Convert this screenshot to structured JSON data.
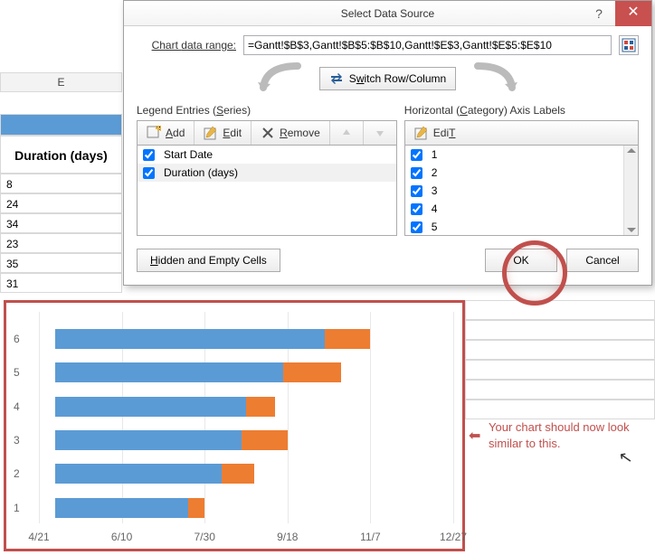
{
  "dialog": {
    "title": "Select Data Source",
    "range_label_pre": "Chart ",
    "range_label_u": "d",
    "range_label_post": "ata range:",
    "range_value": "=Gantt!$B$3,Gantt!$B$5:$B$10,Gantt!$E$3,Gantt!$E$5:$E$10",
    "switch_label_pre": "S",
    "switch_label_u": "w",
    "switch_label_post": "itch Row/Column",
    "legend_title_pre": "Legend Entries (",
    "legend_title_u": "S",
    "legend_title_post": "eries)",
    "hlabels_title_pre": "Horizontal (",
    "hlabels_title_u": "C",
    "hlabels_title_post": "ategory) Axis Labels",
    "btn_add_u": "A",
    "btn_add_post": "dd",
    "btn_edit_u": "E",
    "btn_edit_post": "dit",
    "btn_edit2_u": "T",
    "btn_edit2_pre": "Edi",
    "btn_remove_u": "R",
    "btn_remove_post": "emove",
    "series": [
      {
        "label": "Start Date",
        "checked": true
      },
      {
        "label": "Duration (days)",
        "checked": true
      }
    ],
    "categories": [
      {
        "label": "1",
        "checked": true
      },
      {
        "label": "2",
        "checked": true
      },
      {
        "label": "3",
        "checked": true
      },
      {
        "label": "4",
        "checked": true
      },
      {
        "label": "5",
        "checked": true
      }
    ],
    "hidden_cells_u": "H",
    "hidden_cells_post": "idden and Empty Cells",
    "ok_label": "OK",
    "cancel_label": "Cancel"
  },
  "sheet": {
    "col_header": "E",
    "duration_header": "Duration (days)",
    "values": [
      "8",
      "24",
      "34",
      "23",
      "35",
      "31"
    ]
  },
  "annotation": {
    "arrow": "⬅",
    "text": "Your chart should now look similar to this.",
    "cursor": "↖"
  },
  "chart_data": {
    "type": "bar",
    "orientation": "horizontal",
    "xlabel": "",
    "ylabel": "",
    "x_ticks": [
      "4/21",
      "6/10",
      "7/30",
      "9/18",
      "11/7",
      "12/27"
    ],
    "x_tick_positions_pct": [
      0,
      20,
      40,
      60,
      80,
      100
    ],
    "categories": [
      "1",
      "2",
      "3",
      "4",
      "5",
      "6"
    ],
    "series": [
      {
        "name": "Start Date",
        "color": "#5b9bd5",
        "start_pct": [
          4,
          4,
          4,
          4,
          4,
          4
        ],
        "end_pct": [
          36,
          44,
          49,
          50,
          59,
          69
        ]
      },
      {
        "name": "Duration (days)",
        "color": "#ed7d31",
        "start_pct": [
          36,
          44,
          49,
          50,
          59,
          69
        ],
        "end_pct": [
          40,
          52,
          60,
          57,
          73,
          80
        ]
      }
    ],
    "y_positions_pct": [
      88,
      72,
      56,
      40,
      24,
      8
    ]
  }
}
